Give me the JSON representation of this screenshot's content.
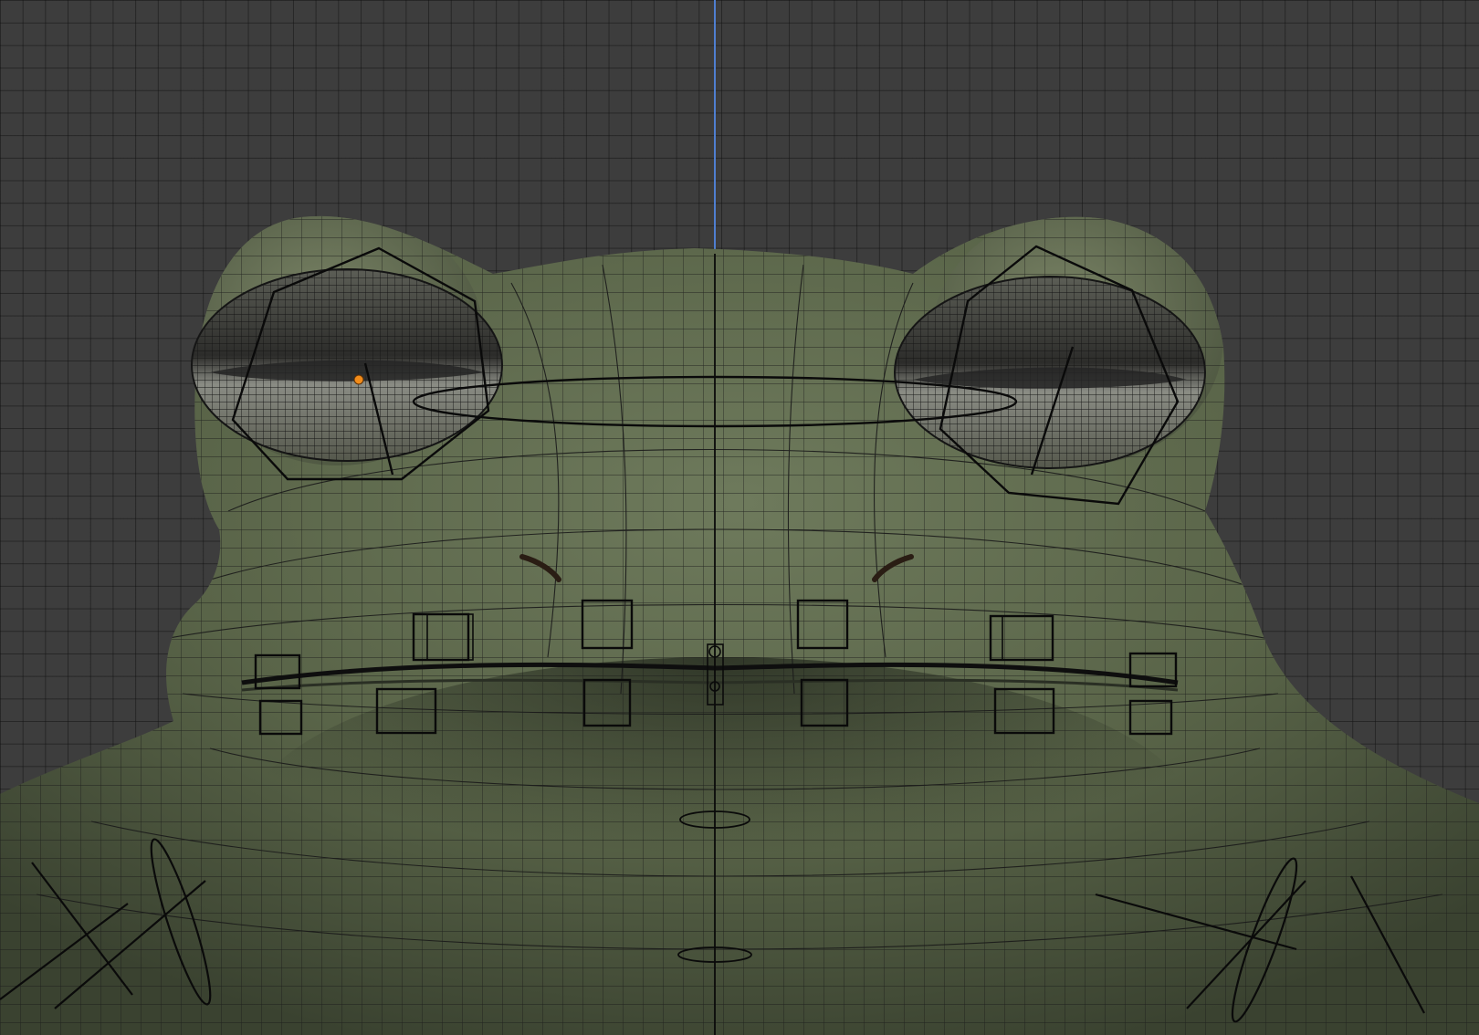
{
  "viewport": {
    "mode": "3d-viewport",
    "view": "front-orthographic",
    "grid": true,
    "background_color": "#3d3d3d",
    "axis_line_color": "#4f7fd0",
    "object": "frog-head-mesh",
    "overlays": [
      "wireframe",
      "rig-controls"
    ],
    "active_origin_color": "#f28c1a"
  }
}
